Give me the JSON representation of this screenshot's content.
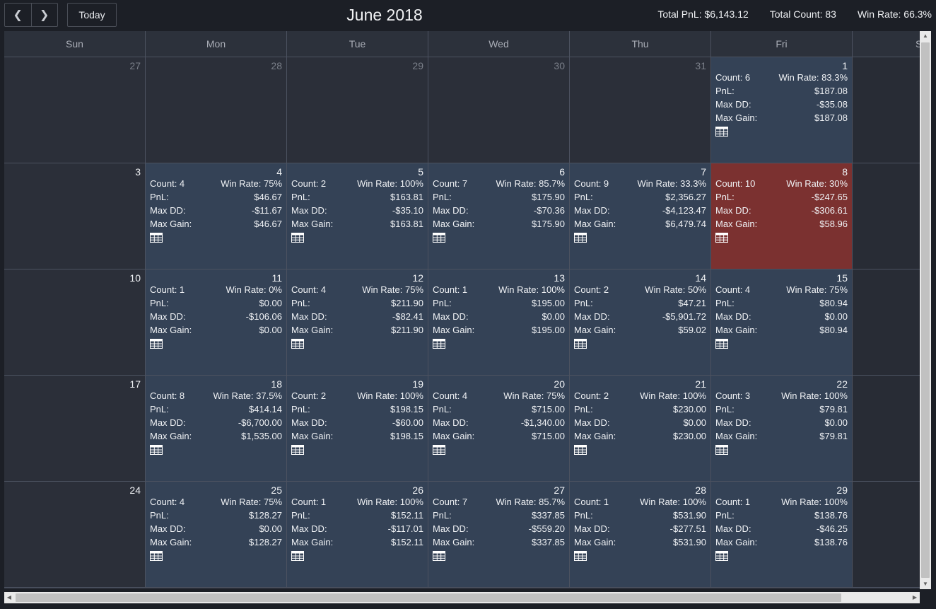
{
  "toolbar": {
    "prev_icon": "chevron-left-icon",
    "next_icon": "chevron-right-icon",
    "prev_glyph": "❮",
    "next_glyph": "❯",
    "today_label": "Today",
    "title": "June 2018"
  },
  "summary": {
    "total_pnl": "Total PnL: $6,143.12",
    "total_count": "Total Count: 83",
    "win_rate": "Win Rate: 66.3%"
  },
  "labels": {
    "pnl": "PnL:",
    "max_dd": "Max DD:",
    "max_gain": "Max Gain:"
  },
  "weekdays": [
    "Sun",
    "Mon",
    "Tue",
    "Wed",
    "Thu",
    "Fri",
    "Sat"
  ],
  "colors": {
    "profit_cell": "#344256",
    "loss_cell": "#7b3130",
    "empty_cell": "#2b2f39"
  },
  "weeks": [
    [
      {
        "date": "27",
        "other": true
      },
      {
        "date": "28",
        "other": true
      },
      {
        "date": "29",
        "other": true
      },
      {
        "date": "30",
        "other": true
      },
      {
        "date": "31",
        "other": true
      },
      {
        "date": "1",
        "count": "Count: 6",
        "win_rate": "Win Rate: 83.3%",
        "pnl": "$187.08",
        "max_dd": "-$35.08",
        "max_gain": "$187.08",
        "status": "profit"
      },
      {
        "date": "",
        "blank": true
      }
    ],
    [
      {
        "date": "3"
      },
      {
        "date": "4",
        "count": "Count: 4",
        "win_rate": "Win Rate: 75%",
        "pnl": "$46.67",
        "max_dd": "-$11.67",
        "max_gain": "$46.67",
        "status": "profit"
      },
      {
        "date": "5",
        "count": "Count: 2",
        "win_rate": "Win Rate: 100%",
        "pnl": "$163.81",
        "max_dd": "-$35.10",
        "max_gain": "$163.81",
        "status": "profit"
      },
      {
        "date": "6",
        "count": "Count: 7",
        "win_rate": "Win Rate: 85.7%",
        "pnl": "$175.90",
        "max_dd": "-$70.36",
        "max_gain": "$175.90",
        "status": "profit"
      },
      {
        "date": "7",
        "count": "Count: 9",
        "win_rate": "Win Rate: 33.3%",
        "pnl": "$2,356.27",
        "max_dd": "-$4,123.47",
        "max_gain": "$6,479.74",
        "status": "profit"
      },
      {
        "date": "8",
        "count": "Count: 10",
        "win_rate": "Win Rate: 30%",
        "pnl": "-$247.65",
        "max_dd": "-$306.61",
        "max_gain": "$58.96",
        "status": "loss"
      },
      {
        "date": "",
        "blank": true
      }
    ],
    [
      {
        "date": "10"
      },
      {
        "date": "11",
        "count": "Count: 1",
        "win_rate": "Win Rate: 0%",
        "pnl": "$0.00",
        "max_dd": "-$106.06",
        "max_gain": "$0.00",
        "status": "profit"
      },
      {
        "date": "12",
        "count": "Count: 4",
        "win_rate": "Win Rate: 75%",
        "pnl": "$211.90",
        "max_dd": "-$82.41",
        "max_gain": "$211.90",
        "status": "profit"
      },
      {
        "date": "13",
        "count": "Count: 1",
        "win_rate": "Win Rate: 100%",
        "pnl": "$195.00",
        "max_dd": "$0.00",
        "max_gain": "$195.00",
        "status": "profit"
      },
      {
        "date": "14",
        "count": "Count: 2",
        "win_rate": "Win Rate: 50%",
        "pnl": "$47.21",
        "max_dd": "-$5,901.72",
        "max_gain": "$59.02",
        "status": "profit"
      },
      {
        "date": "15",
        "count": "Count: 4",
        "win_rate": "Win Rate: 75%",
        "pnl": "$80.94",
        "max_dd": "$0.00",
        "max_gain": "$80.94",
        "status": "profit"
      },
      {
        "date": "",
        "blank": true
      }
    ],
    [
      {
        "date": "17"
      },
      {
        "date": "18",
        "count": "Count: 8",
        "win_rate": "Win Rate: 37.5%",
        "pnl": "$414.14",
        "max_dd": "-$6,700.00",
        "max_gain": "$1,535.00",
        "status": "profit"
      },
      {
        "date": "19",
        "count": "Count: 2",
        "win_rate": "Win Rate: 100%",
        "pnl": "$198.15",
        "max_dd": "-$60.00",
        "max_gain": "$198.15",
        "status": "profit"
      },
      {
        "date": "20",
        "count": "Count: 4",
        "win_rate": "Win Rate: 75%",
        "pnl": "$715.00",
        "max_dd": "-$1,340.00",
        "max_gain": "$715.00",
        "status": "profit"
      },
      {
        "date": "21",
        "count": "Count: 2",
        "win_rate": "Win Rate: 100%",
        "pnl": "$230.00",
        "max_dd": "$0.00",
        "max_gain": "$230.00",
        "status": "profit"
      },
      {
        "date": "22",
        "count": "Count: 3",
        "win_rate": "Win Rate: 100%",
        "pnl": "$79.81",
        "max_dd": "$0.00",
        "max_gain": "$79.81",
        "status": "profit"
      },
      {
        "date": "",
        "blank": true
      }
    ],
    [
      {
        "date": "24"
      },
      {
        "date": "25",
        "count": "Count: 4",
        "win_rate": "Win Rate: 75%",
        "pnl": "$128.27",
        "max_dd": "$0.00",
        "max_gain": "$128.27",
        "status": "profit"
      },
      {
        "date": "26",
        "count": "Count: 1",
        "win_rate": "Win Rate: 100%",
        "pnl": "$152.11",
        "max_dd": "-$117.01",
        "max_gain": "$152.11",
        "status": "profit"
      },
      {
        "date": "27",
        "count": "Count: 7",
        "win_rate": "Win Rate: 85.7%",
        "pnl": "$337.85",
        "max_dd": "-$559.20",
        "max_gain": "$337.85",
        "status": "profit"
      },
      {
        "date": "28",
        "count": "Count: 1",
        "win_rate": "Win Rate: 100%",
        "pnl": "$531.90",
        "max_dd": "-$277.51",
        "max_gain": "$531.90",
        "status": "profit"
      },
      {
        "date": "29",
        "count": "Count: 1",
        "win_rate": "Win Rate: 100%",
        "pnl": "$138.76",
        "max_dd": "-$46.25",
        "max_gain": "$138.76",
        "status": "profit"
      },
      {
        "date": "",
        "blank": true
      }
    ]
  ],
  "scrollbars": {
    "up_icon": "arrow-up-icon",
    "down_icon": "arrow-down-icon",
    "left_icon": "arrow-left-icon",
    "right_icon": "arrow-right-icon"
  }
}
